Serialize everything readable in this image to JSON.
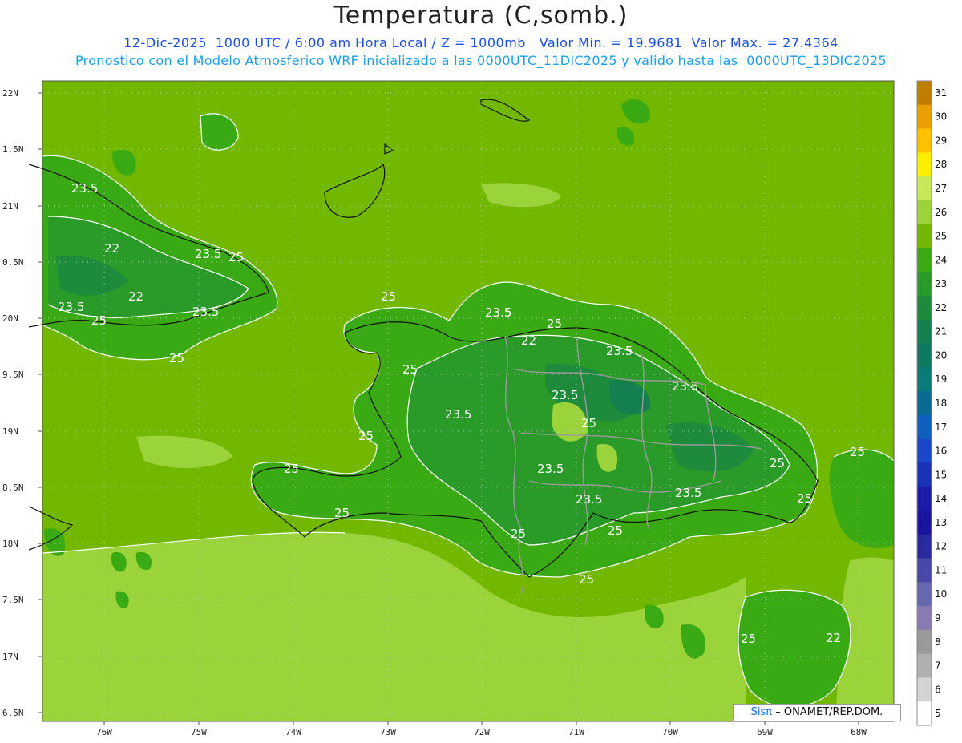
{
  "header": {
    "title": "Temperatura (C,somb.)",
    "line1": "12-Dic-2025  1000 UTC / 6:00 am Hora Local / Z = 1000mb   Valor Min. = 19.9681  Valor Max. = 27.4364",
    "line2": "Pronostico con el Modelo Atmosferico WRF inicializado a las 0000UTC_11DIC2025 y valido hasta las  0000UTC_13DIC2025"
  },
  "axes": {
    "lat_labels": [
      "22N",
      "1.5N",
      "21N",
      "0.5N",
      "20N",
      "9.5N",
      "19N",
      "8.5N",
      "18N",
      "7.5N",
      "17N",
      "6.5N"
    ],
    "lon_labels": [
      "76W",
      "75W",
      "74W",
      "73W",
      "72W",
      "71W",
      "70W",
      "69W",
      "68W"
    ]
  },
  "colorbar": {
    "levels": [
      "31",
      "30",
      "29",
      "28",
      "27",
      "26",
      "25",
      "24",
      "23",
      "22",
      "21",
      "20",
      "19",
      "18",
      "17",
      "16",
      "15",
      "14",
      "13",
      "12",
      "11",
      "10",
      "9",
      "8",
      "7",
      "6",
      "5"
    ],
    "colors": [
      "#c07d00",
      "#e8a000",
      "#ffc000",
      "#ffee00",
      "#c8e85a",
      "#9ad43a",
      "#72b800",
      "#3aaa14",
      "#2a9a28",
      "#1e8a3c",
      "#148050",
      "#107a60",
      "#0c7a78",
      "#0a6a94",
      "#1060c0",
      "#1848c8",
      "#1a32b8",
      "#1a1ca8",
      "#1a14a0",
      "#2a2aa0",
      "#4848a8",
      "#6868b0",
      "#8a7ab4",
      "#9a9a9a",
      "#b0b0b0",
      "#d4d4d4",
      "#ffffff"
    ]
  },
  "contour_labels": [
    "23.5",
    "22",
    "23.5",
    "25",
    "22",
    "23.5",
    "25",
    "23.5",
    "25",
    "25",
    "23.5",
    "22",
    "23.5",
    "25",
    "23.5",
    "25",
    "25",
    "23.5",
    "25",
    "25",
    "25",
    "23.5",
    "23.5",
    "23.5",
    "25",
    "25",
    "25",
    "23.5",
    "25",
    "25",
    "25",
    "25",
    "22"
  ],
  "credit": {
    "brand": "Sisπ",
    "text": "– ONAMET/REP.DOM."
  }
}
